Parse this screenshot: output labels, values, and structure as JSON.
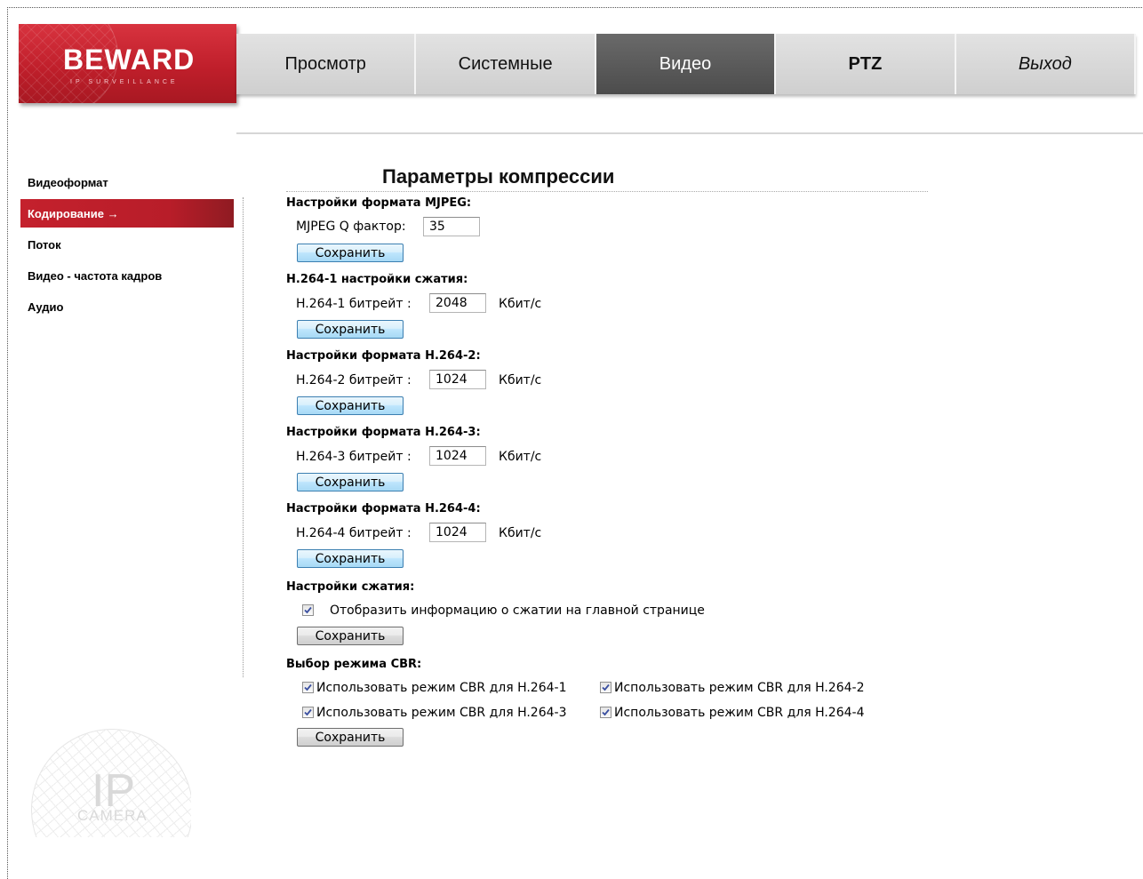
{
  "logo": {
    "brand": "BEWARD",
    "tagline": "IP SURVEILLANCE"
  },
  "topnav": {
    "view": "Просмотр",
    "system": "Системные",
    "video": "Видео",
    "ptz": "PTZ",
    "exit": "Выход"
  },
  "sidebar": {
    "items": [
      {
        "label": "Видеоформат"
      },
      {
        "label": "Кодирование →"
      },
      {
        "label": "Поток"
      },
      {
        "label": "Видео - частота кадров"
      },
      {
        "label": "Аудио"
      }
    ],
    "active_index": 1,
    "watermark": {
      "ip": "IP",
      "camera": "CAMERA"
    }
  },
  "page": {
    "title": "Параметры компрессии"
  },
  "mjpeg": {
    "heading": "Настройки формата MJPEG:",
    "label": "MJPEG Q фактор:",
    "value": "35",
    "save": "Сохранить"
  },
  "h264_1": {
    "heading": "H.264-1 настройки сжатия:",
    "label": "H.264-1 битрейт :",
    "value": "2048",
    "unit": "Кбит/с",
    "save": "Сохранить"
  },
  "h264_2": {
    "heading": "Настройки формата H.264-2:",
    "label": "H.264-2 битрейт :",
    "value": "1024",
    "unit": "Кбит/с",
    "save": "Сохранить"
  },
  "h264_3": {
    "heading": "Настройки формата H.264-3:",
    "label": "H.264-3 битрейт :",
    "value": "1024",
    "unit": "Кбит/с",
    "save": "Сохранить"
  },
  "h264_4": {
    "heading": "Настройки формата H.264-4:",
    "label": "H.264-4 битрейт :",
    "value": "1024",
    "unit": "Кбит/с",
    "save": "Сохранить"
  },
  "compression": {
    "heading": "Настройки сжатия:",
    "show_info_label": "Отобразить информацию о сжатии на главной странице",
    "show_info_checked": true,
    "save": "Сохранить"
  },
  "cbr": {
    "heading": "Выбор режима CBR:",
    "h264_1": {
      "label": "Использовать режим CBR для H.264-1",
      "checked": true
    },
    "h264_2": {
      "label": "Использовать режим CBR для H.264-2",
      "checked": true
    },
    "h264_3": {
      "label": "Использовать режим CBR для H.264-3",
      "checked": true
    },
    "h264_4": {
      "label": "Использовать режим CBR для H.264-4",
      "checked": true
    },
    "save": "Сохранить"
  },
  "colors": {
    "brand_red": "#c4212d",
    "nav_active": "#555555",
    "nav_bg": "#d8d8d8"
  }
}
